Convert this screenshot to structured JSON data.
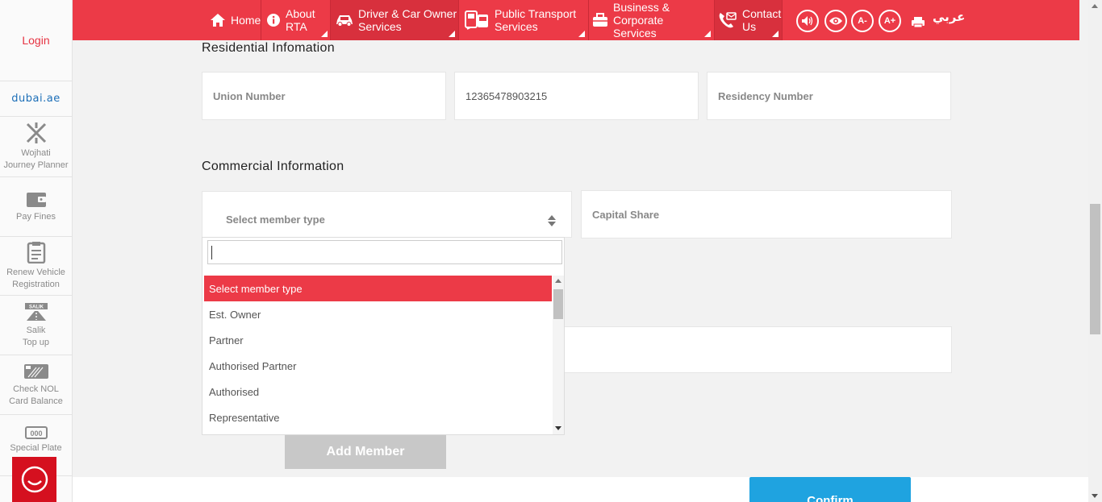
{
  "colors": {
    "brand_red": "#ec3a47",
    "confirm_blue": "#1fa3e0",
    "add_member_gray": "#c8c8c8"
  },
  "sidebar": {
    "login": "Login",
    "dubai_logo": "dubai.ae",
    "items": [
      {
        "label1": "Wojhati",
        "label2": "Journey Planner",
        "icon": "wojhati-icon"
      },
      {
        "label1": "Pay Fines",
        "label2": "",
        "icon": "wallet-icon"
      },
      {
        "label1": "Renew Vehicle",
        "label2": "Registration",
        "icon": "clipboard-icon"
      },
      {
        "label1": "Salik",
        "label2": "Top up",
        "icon": "salik-icon"
      },
      {
        "label1": "Check NOL",
        "label2": "Card Balance",
        "icon": "nol-card-icon"
      },
      {
        "label1": "Special Plate",
        "label2": "",
        "icon": "plate-icon"
      }
    ],
    "plate_text": "000",
    "salik_text": "SALIK"
  },
  "nav": {
    "home": "Home",
    "about": [
      "About",
      "RTA"
    ],
    "driver": [
      "Driver & Car Owner",
      "Services"
    ],
    "transport": [
      "Public Transport",
      "Services"
    ],
    "business": [
      "Business & Corporate",
      "Services"
    ],
    "contact": [
      "Contact",
      "Us"
    ],
    "font_decrease": "A-",
    "font_increase": "A+",
    "language": "عربي"
  },
  "residential": {
    "title": "Residential Infomation",
    "union_placeholder": "Union Number",
    "id_value": "12365478903215",
    "residency_placeholder": "Residency Number"
  },
  "commercial": {
    "title": "Commercial Information",
    "member_select_label": "Select member type",
    "capital_share_placeholder": "Capital Share",
    "options": [
      "Select member type",
      "Est. Owner",
      "Partner",
      "Authorised Partner",
      "Authorised",
      "Representative"
    ]
  },
  "buttons": {
    "add_member": "Add Member",
    "confirm": "Confirm"
  }
}
